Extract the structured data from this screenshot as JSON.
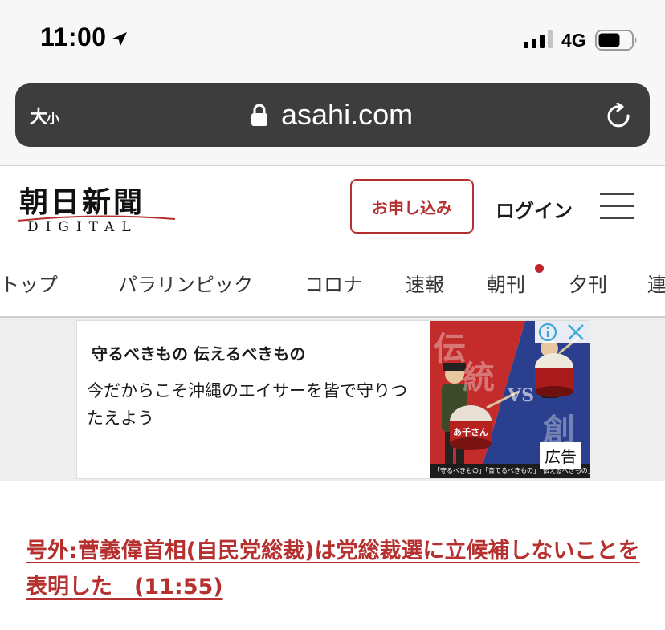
{
  "status_bar": {
    "time": "11:00",
    "network": "4G"
  },
  "browser": {
    "text_size_large": "大",
    "text_size_small": "小",
    "url": "asahi.com"
  },
  "header": {
    "logo_title": "朝日新聞",
    "logo_subtitle": "DIGITAL",
    "subscribe_label": "お申し込み",
    "login_label": "ログイン"
  },
  "nav": {
    "tabs": [
      {
        "label": "トップ"
      },
      {
        "label": "パラリンピック"
      },
      {
        "label": "コロナ"
      },
      {
        "label": "速報"
      },
      {
        "label": "朝刊"
      },
      {
        "label": "夕刊"
      },
      {
        "label": "連"
      }
    ]
  },
  "ad": {
    "headline": "守るべきもの 伝えるべきもの",
    "body": "今だからこそ沖縄のエイサーを皆で守りつたえよう",
    "image_text_1": "伝",
    "image_text_2": "統",
    "image_text_3": "VS",
    "image_text_4": "創",
    "drum_text": "あ千さん",
    "caption": "「守るべきもの」「育てるべきもの」「伝えるべきもの」",
    "label": "広告"
  },
  "breaking": {
    "text": "号外:菅義偉首相(自民党総裁)は党総裁選に立候補しないことを表明した　(11:55)"
  },
  "colors": {
    "brand_red": "#b5302e",
    "address_bar": "#3d3d3d",
    "notification_dot": "#c0272d",
    "ad_blue": "#2b3f8f",
    "ad_red": "#c42b2b"
  }
}
